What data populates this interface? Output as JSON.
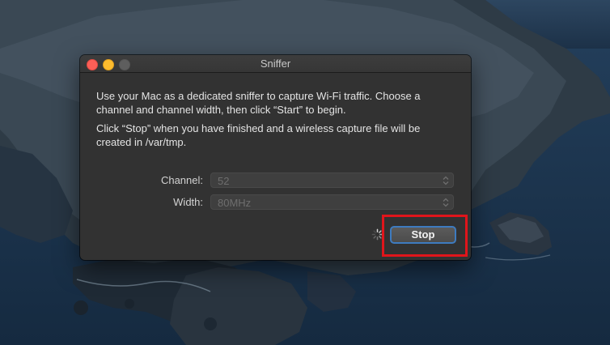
{
  "window": {
    "title": "Sniffer"
  },
  "content": {
    "paragraph1": "Use your Mac as a dedicated sniffer to capture Wi-Fi traffic. Choose a channel and channel width, then click “Start” to begin.",
    "paragraph2": "Click “Stop” when you have finished and a wireless capture file will be created in /var/tmp."
  },
  "form": {
    "channel_label": "Channel:",
    "channel_value": "52",
    "width_label": "Width:",
    "width_value": "80MHz"
  },
  "actions": {
    "stop_label": "Stop"
  },
  "colors": {
    "highlight": "#e0151b",
    "focus_ring": "#3e7bbf",
    "window_bg": "#323232"
  }
}
